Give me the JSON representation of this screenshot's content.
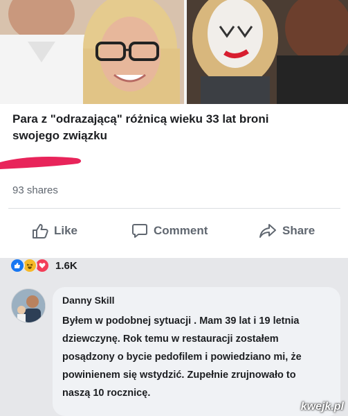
{
  "post": {
    "headline": "Para z \"odrazającą\" różnicą wieku 33 lat broni swojego związku",
    "shares": "93 shares"
  },
  "actions": {
    "like": "Like",
    "comment": "Comment",
    "share": "Share"
  },
  "reactions": {
    "count": "1.6K",
    "icons": [
      "like-icon",
      "haha-icon",
      "love-icon"
    ],
    "colors": {
      "like": "#1877f2",
      "haha": "#f7b928",
      "love": "#f33e58"
    }
  },
  "comment": {
    "author": "Danny Skill",
    "text": "Byłem w podobnej sytuacji . Mam 39 lat i 19 letnia dziewczynę. Rok temu w restauracji zostałem posądzony o bycie pedofilem i powiedziano mi, że powinienem się wstydzić. Zupełnie zrujnowało to naszą 10 rocznicę."
  },
  "watermark": "kwejk.pl",
  "colors": {
    "accent_pink": "#e8245a",
    "text_primary": "#1c1e21",
    "text_secondary": "#606770"
  }
}
